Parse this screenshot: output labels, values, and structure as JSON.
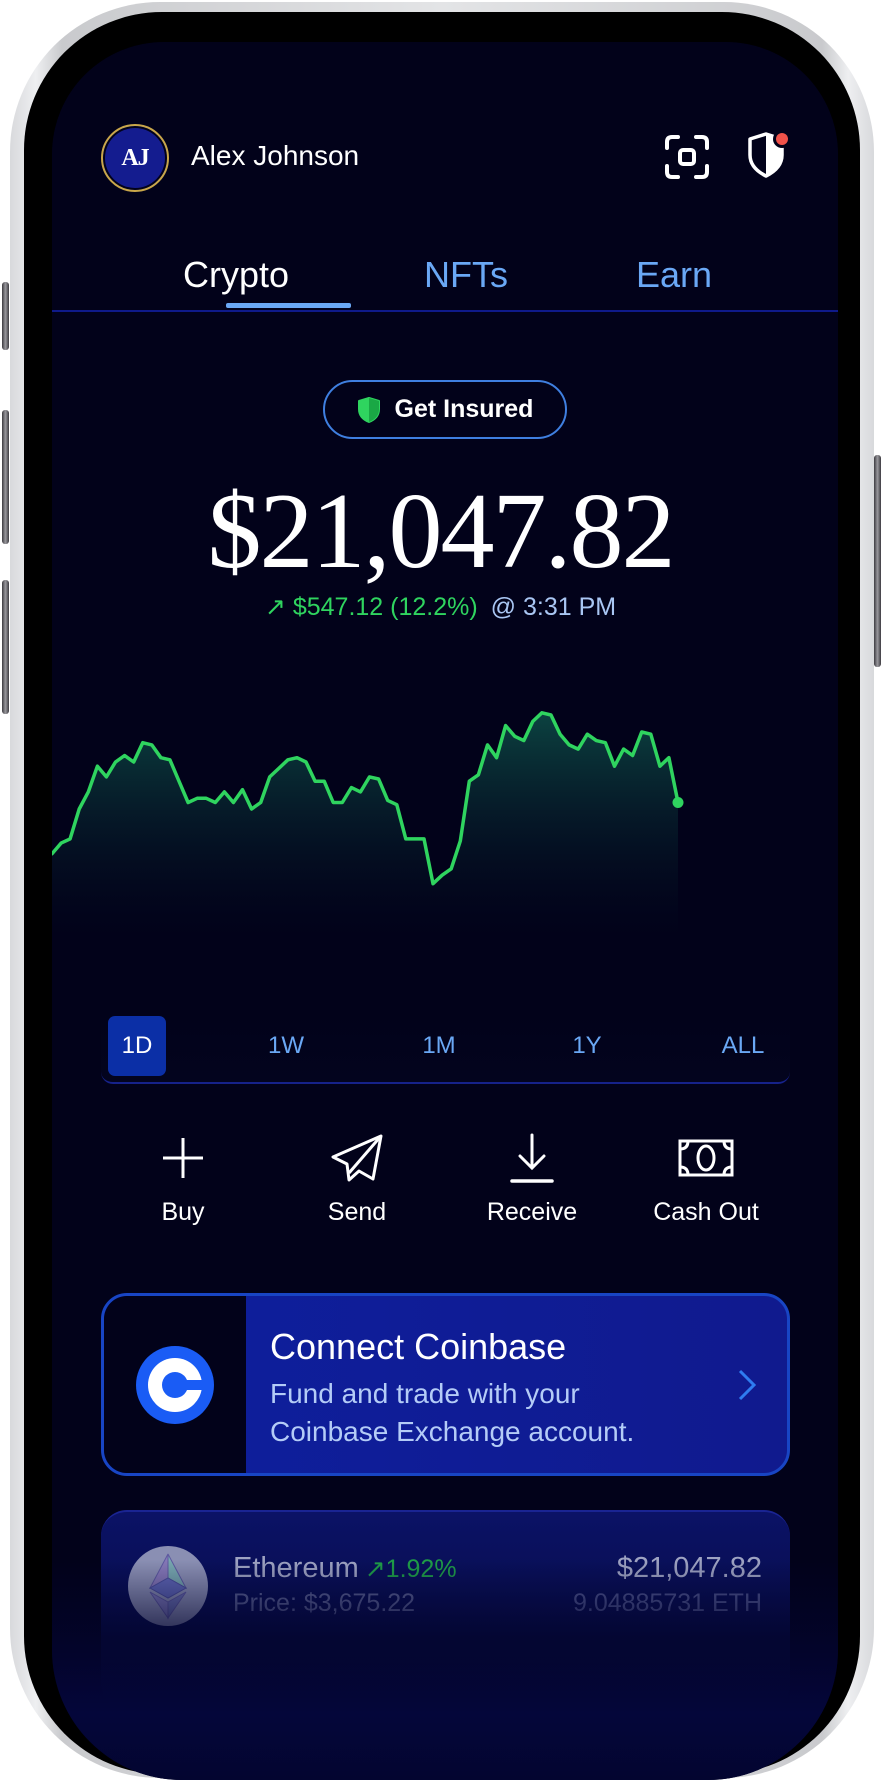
{
  "header": {
    "avatar_initials": "AJ",
    "user_name": "Alex Johnson",
    "icons": [
      "scan-icon",
      "shield-alert-icon"
    ],
    "notification_dot_color": "#f0524a"
  },
  "tabs": [
    {
      "label": "Crypto",
      "active": true
    },
    {
      "label": "NFTs",
      "active": false
    },
    {
      "label": "Earn",
      "active": false
    }
  ],
  "insured_button": {
    "label": "Get Insured",
    "icon": "shield-icon"
  },
  "balance": {
    "amount": "$21,047.82",
    "change_arrow": "↗",
    "change": "$547.12 (12.2%)",
    "time": "@ 3:31 PM"
  },
  "timeframes": [
    {
      "label": "1D",
      "active": true
    },
    {
      "label": "1W",
      "active": false
    },
    {
      "label": "1M",
      "active": false
    },
    {
      "label": "1Y",
      "active": false
    },
    {
      "label": "ALL",
      "active": false
    }
  ],
  "actions": [
    {
      "label": "Buy",
      "icon": "plus-icon"
    },
    {
      "label": "Send",
      "icon": "paper-plane-icon"
    },
    {
      "label": "Receive",
      "icon": "download-icon"
    },
    {
      "label": "Cash Out",
      "icon": "cash-icon"
    }
  ],
  "coinbase_card": {
    "title": "Connect Coinbase",
    "desc_line1": "Fund and trade with your",
    "desc_line2": "Coinbase Exchange account.",
    "icon": "coinbase-logo-icon"
  },
  "assets": [
    {
      "name": "Ethereum",
      "change": "↗1.92%",
      "price": "Price: $3,675.22",
      "value": "$21,047.82",
      "amount": "9.04885731 ETH",
      "icon": "ethereum-logo-icon"
    }
  ],
  "colors": {
    "background": "#02021a",
    "accent": "#6aa8f5",
    "positive": "#2fd45f",
    "card": "#0e1f9e",
    "active_timeframe": "#0b2fa6"
  },
  "chart_data": {
    "type": "area",
    "title": "",
    "xlabel": "",
    "ylabel": "",
    "timeframe": "1D",
    "grid": false,
    "legend": "none",
    "series": [
      {
        "name": "Portfolio value (relative)",
        "values": [
          38,
          43,
          45,
          59,
          67,
          79,
          74,
          81,
          84,
          81,
          90,
          89,
          83,
          82,
          72,
          62,
          64,
          64,
          62,
          67,
          62,
          68,
          59,
          62,
          74,
          78,
          82,
          83,
          81,
          72,
          72,
          62,
          62,
          69,
          67,
          74,
          73,
          63,
          61,
          45,
          45,
          45,
          24,
          28,
          31,
          44,
          72,
          75,
          89,
          83,
          98,
          93,
          91,
          100,
          104,
          103,
          94,
          89,
          87,
          94,
          91,
          90,
          79,
          87,
          84,
          95,
          94,
          79,
          83,
          62
        ]
      }
    ],
    "y_range": [
      0,
      110
    ]
  }
}
